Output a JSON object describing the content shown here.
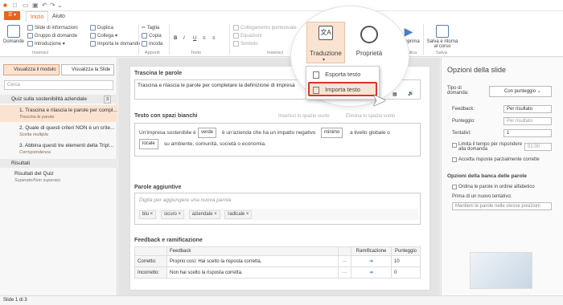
{
  "tabs": {
    "home": "Inizio",
    "help": "Aiuto"
  },
  "ribbon": {
    "domande": "Domande",
    "slide_info": "Slide di informazioni",
    "gruppo": "Gruppo di domande",
    "introduzione": "Introduzione",
    "duplica": "Duplica",
    "collega": "Collega",
    "importa_domande": "Importa le domande",
    "taglia": "Taglia",
    "copia": "Copia",
    "incolla": "Incolla",
    "collegamento": "Collegamento ipertestuale",
    "equazioni": "Equazioni",
    "simbolo": "Simbolo",
    "traduzione": "Traduzione",
    "proprieta": "Proprietà",
    "anteprima": "Anteprima",
    "salva": "Salva e ritorna al corso",
    "grp_inserisci": "Inserisci",
    "grp_appunti": "Appunti",
    "grp_testo": "Testo",
    "grp_inserisci2": "Inserisci",
    "grp_pubblica": "Pubblica",
    "grp_salva": "Salva"
  },
  "dropdown": {
    "esporta": "Esporta testo",
    "importa": "Importa testo"
  },
  "left": {
    "view_module": "Visualizza il modulo",
    "view_slide": "Visualizza la Slide",
    "search_placeholder": "Cerca",
    "quiz_title": "Quiz sulla sostenibilità aziendale",
    "quiz_count": "3",
    "items": [
      {
        "title": "1. Trascina e rilascia le parole per compl...",
        "sub": "Trascina le parole"
      },
      {
        "title": "2. Quale di questi criteri NON è un crite...",
        "sub": "Scelta multipla"
      },
      {
        "title": "3. Abbina questi tre elementi della Tripl...",
        "sub": "Corrispondenza"
      }
    ],
    "results": "Risultati",
    "results_item": "Risultati del Quiz",
    "results_sub": "Superato/Non superato"
  },
  "slide": {
    "sec1": "Trascina le parole",
    "question": "Trascina e rilascia le parole per completare la definizione di impresa",
    "sec2": "Testo con spazi bianchi",
    "insert_blank": "Inserisci lo spazio vuoto",
    "remove_blank": "Elimina lo spazio vuoto",
    "t1": "Un'impresa sostenibile è",
    "w1": "verde",
    "t2": "è un'azienda che ha un impatto negativo",
    "w2": "minimo",
    "t3": "a livello globale o",
    "w3": "locale",
    "t4": "su ambiente, comunità, società o economia.",
    "sec3": "Parole aggiuntive",
    "add_placeholder": "Digita per aggiungere una nuova parola",
    "words": [
      "blu",
      "sicuro",
      "aziendale",
      "radicale"
    ],
    "sec4": "Feedback e ramificazione",
    "col_feedback": "Feedback",
    "col_branch": "Ramificazione",
    "col_score": "Punteggio",
    "rows": [
      {
        "label": "Corretto:",
        "text": "Proprio così: Hai scelto la risposta corretta.",
        "score": "10"
      },
      {
        "label": "Incorretto:",
        "text": "Non hai scelto la risposta corretta.",
        "score": "0"
      }
    ]
  },
  "right": {
    "title": "Opzioni della slide",
    "tipo": "Tipo di domanda:",
    "tipo_val": "Con punteggio",
    "feedback": "Feedback:",
    "feedback_val": "Per risultato",
    "punteggio": "Punteggio:",
    "punteggio_val": "Per risultato",
    "tentativi": "Tentativi:",
    "tentativi_val": "1",
    "limita": "Limita il tempo per rispondere alla domanda",
    "time": "01:00",
    "accetta": "Accetta risposte parzialmente corrette",
    "banca": "Opzioni della banca delle parole",
    "ordina": "Ordina le parole in ordine alfabetico",
    "prima": "Prima di un nuovo tentativo:",
    "mantieni": "Mantieni le parole nelle stesse posizioni"
  },
  "status": "Slide 1 di 3"
}
